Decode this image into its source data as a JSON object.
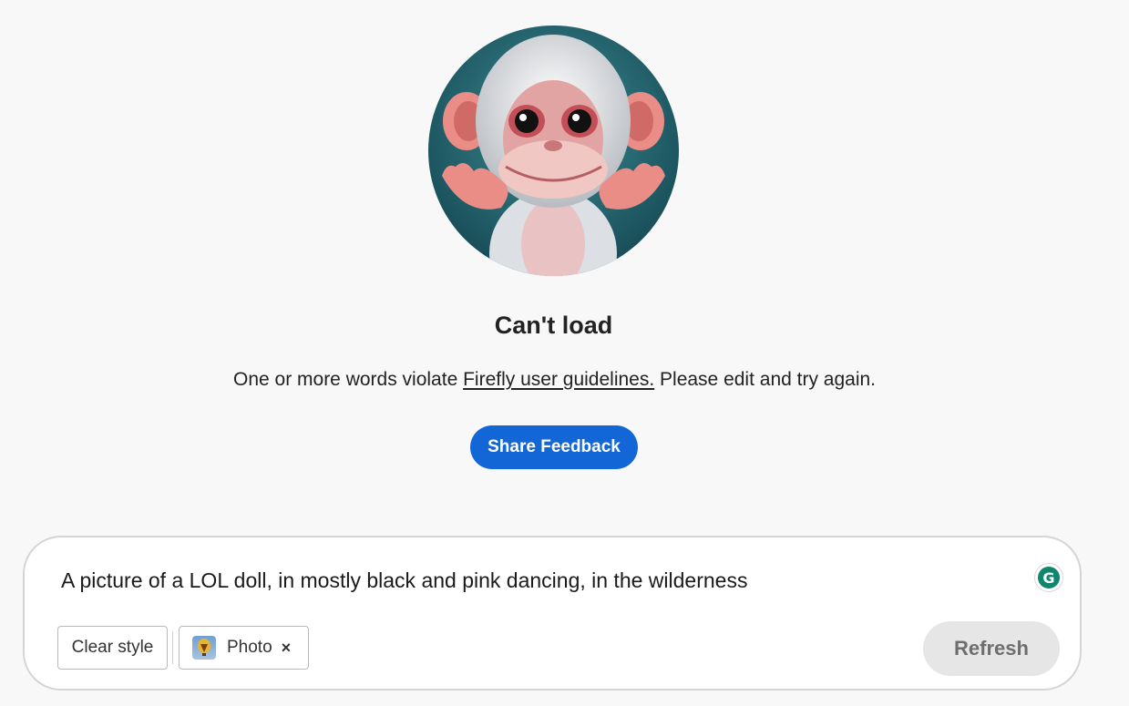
{
  "error": {
    "title": "Can't load",
    "message_before": "One or more words violate ",
    "link_text": "Firefly user guidelines.",
    "message_after": " Please edit and try again."
  },
  "feedback_button": {
    "label": "Share Feedback"
  },
  "prompt": {
    "value": "A picture of a LOL doll, in mostly black and pink dancing, in the wilderness",
    "grammarly_letter": "G"
  },
  "chips": {
    "clear_style_label": "Clear style",
    "photo_label": "Photo",
    "remove_glyph": "×"
  },
  "refresh_button": {
    "label": "Refresh"
  },
  "colors": {
    "primary_button": "#1366d6",
    "grammarly": "#11866f",
    "refresh_bg": "#e6e6e6"
  },
  "icons": {
    "illustration": "monkey-illustration",
    "grammarly": "grammarly-icon",
    "photo_thumb": "hot-air-balloon-icon",
    "remove": "close-icon"
  }
}
